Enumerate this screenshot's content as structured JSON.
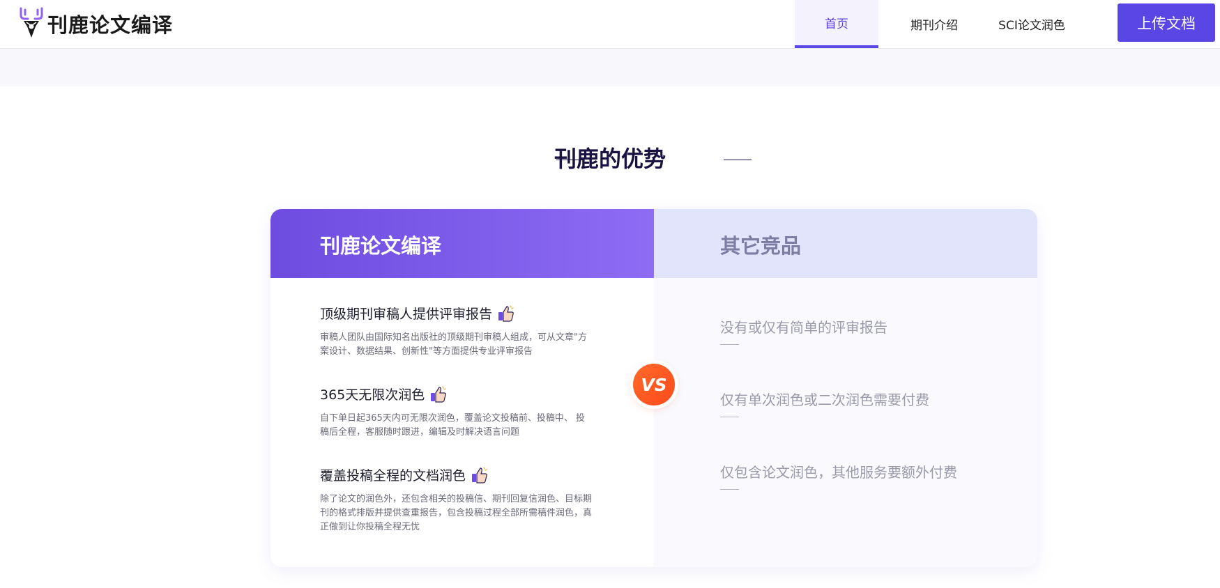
{
  "header": {
    "logo_text": "刊鹿论文编译",
    "nav": [
      {
        "label": "首页",
        "active": true
      },
      {
        "label": "期刊介绍",
        "active": false
      },
      {
        "label": "SCI论文润色",
        "active": false
      }
    ],
    "upload_label": "上传文档"
  },
  "section": {
    "title": "刊鹿的优势"
  },
  "comparison": {
    "left_title": "刊鹿论文编译",
    "right_title": "其它竞品",
    "vs_label": "VS",
    "features": [
      {
        "title": "顶级期刊审稿人提供评审报告",
        "icon": "thumbs-up-icon",
        "desc": "审稿人团队由国际知名出版社的顶级期刊审稿人组成，可从文章\"方案设计、数据结果、创新性\"等方面提供专业评审报告"
      },
      {
        "title": "365天无限次润色",
        "icon": "thumbs-up-icon",
        "desc": "自下单日起365天内可无限次润色，覆盖论文投稿前、投稿中、 投稿后全程，客服随时跟进，编辑及时解决语言问题"
      },
      {
        "title": "覆盖投稿全程的文档润色",
        "icon": "thumbs-up-icon",
        "desc": "除了论文的润色外，还包含相关的投稿信、期刊回复信润色、目标期刊的格式排版并提供查重报告，包含投稿过程全部所需稿件润色，真正做到让你投稿全程无忧"
      }
    ],
    "competitors": [
      "没有或仅有简单的评审报告",
      "仅有单次润色或二次润色需要付费",
      "仅包含论文润色，其他服务要额外付费"
    ]
  },
  "colors": {
    "accent": "#5a45e5",
    "header_gradient_start": "#6d4ce0",
    "header_gradient_end": "#8e6cf4",
    "vs_orange": "#ff5a24"
  }
}
